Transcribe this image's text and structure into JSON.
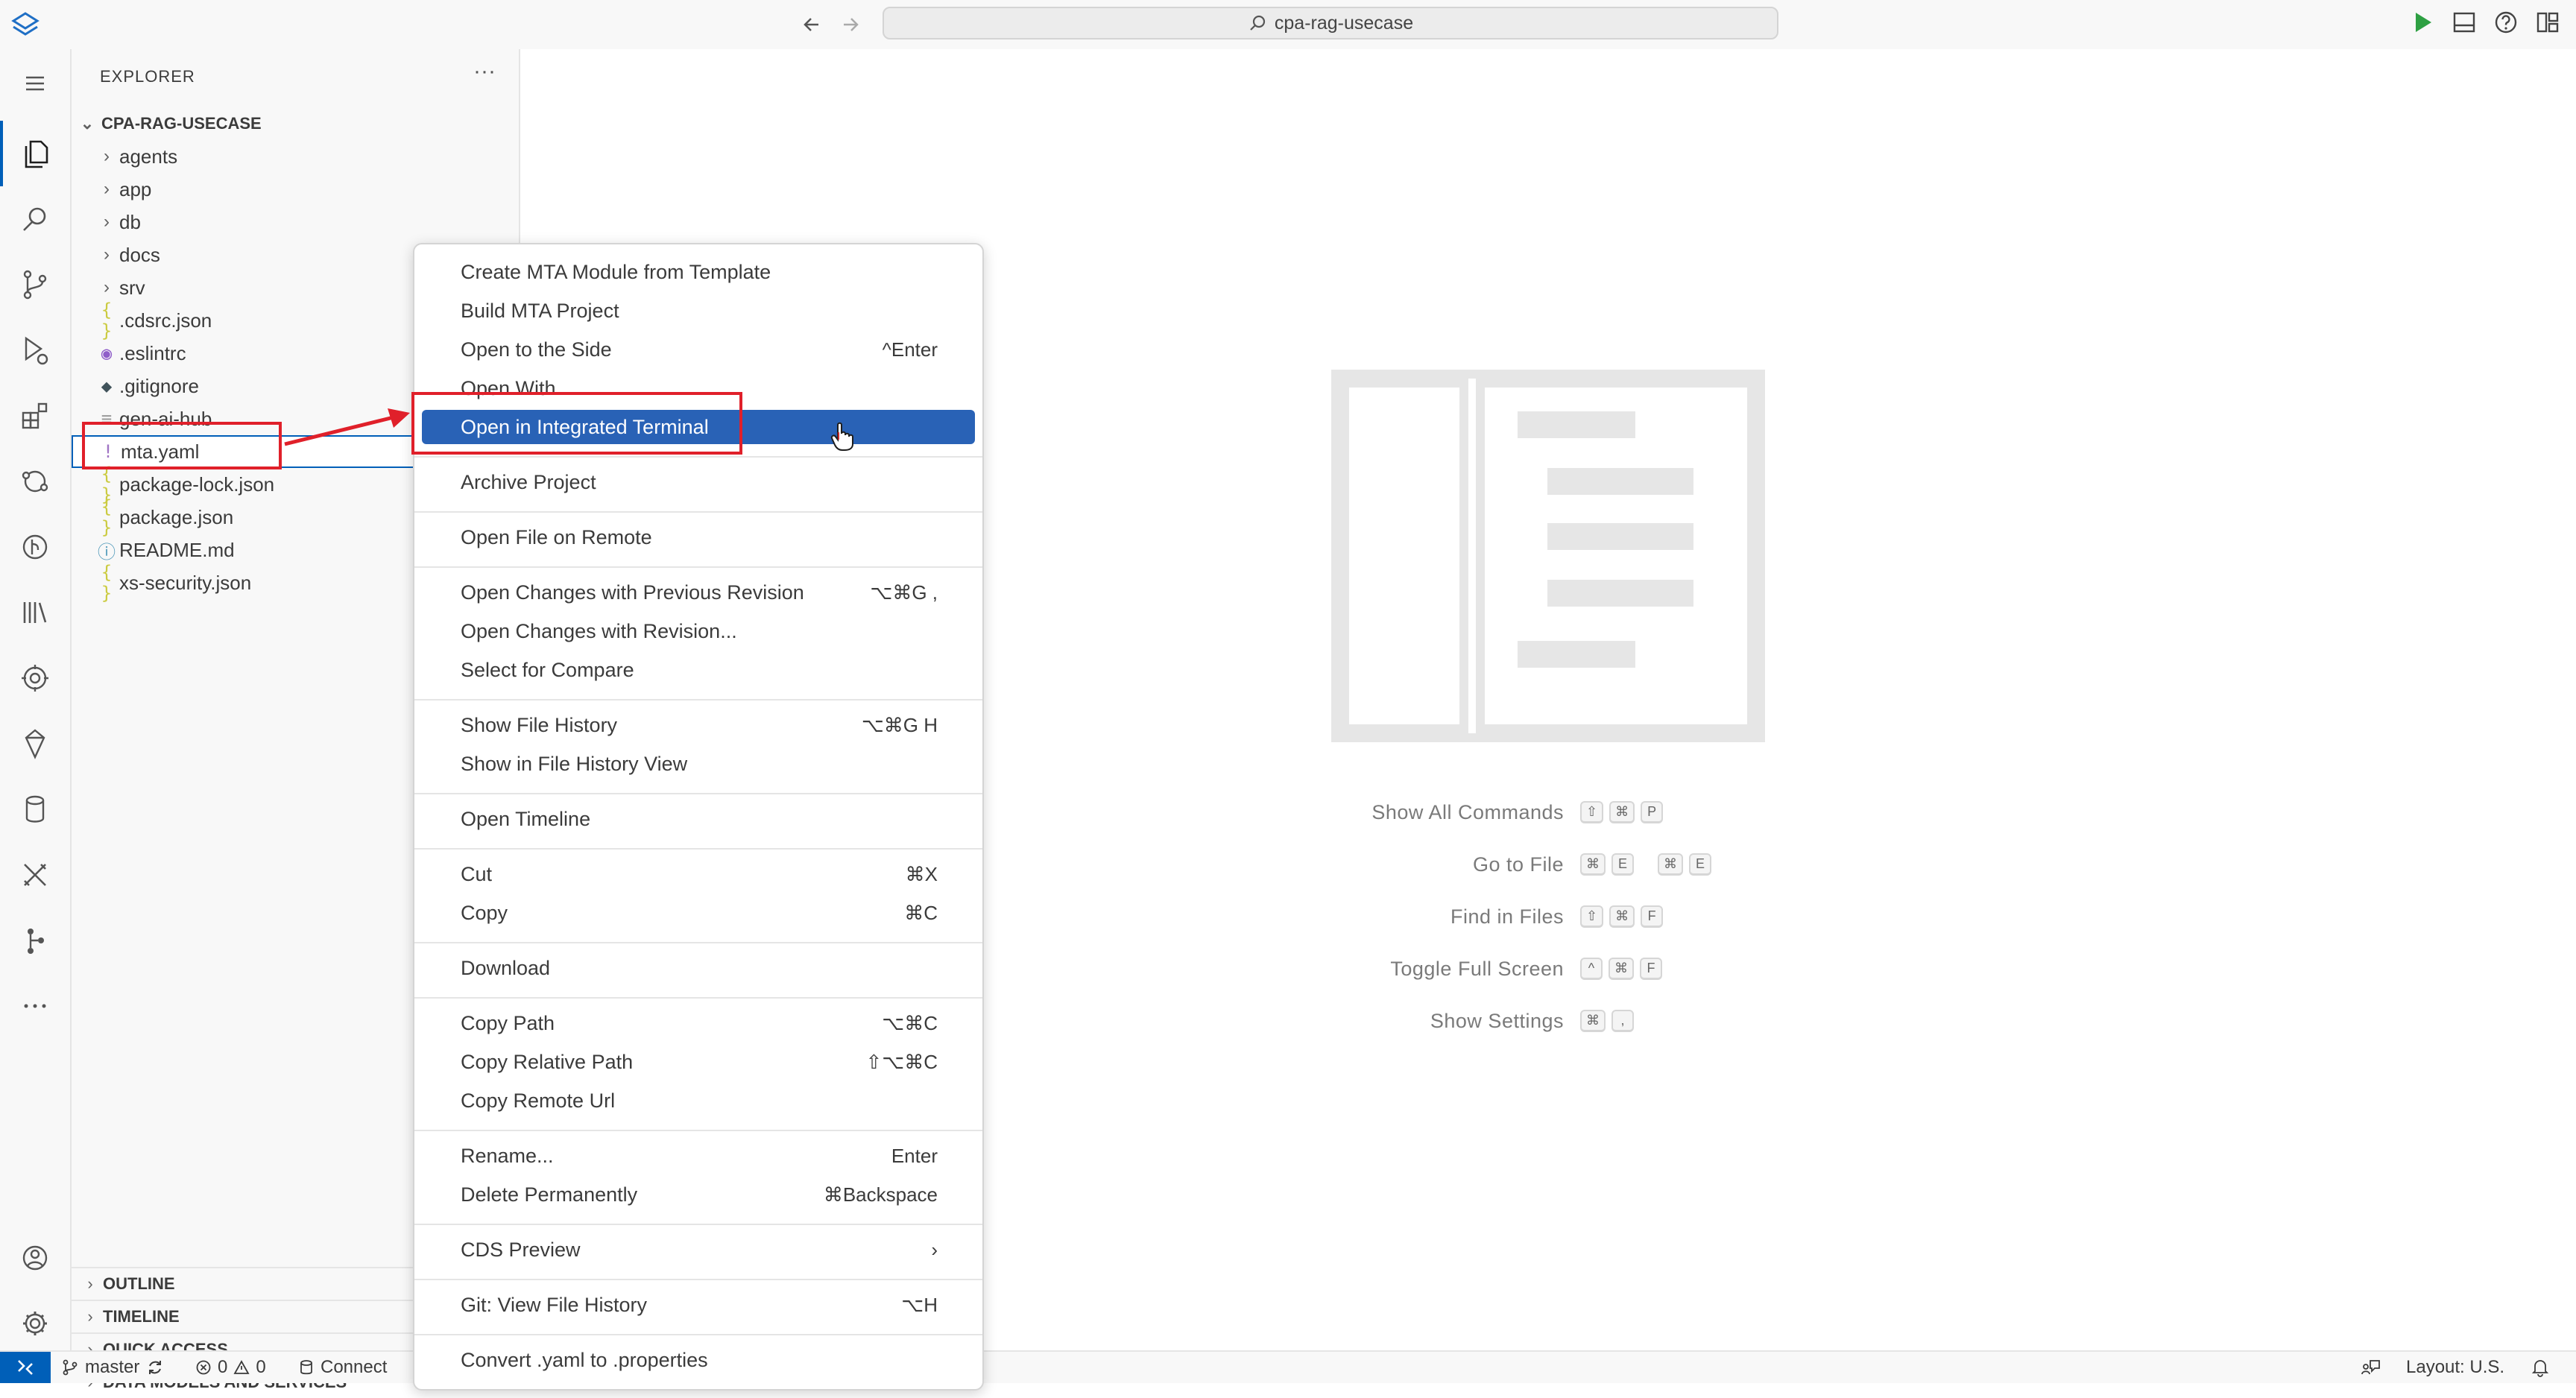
{
  "titlebar": {
    "search_text": "cpa-rag-usecase"
  },
  "sidebar": {
    "title": "EXPLORER",
    "more": "···",
    "root_folder": "CPA-RAG-USECASE",
    "items": [
      {
        "label": "agents",
        "type": "folder",
        "icon": "chevron-right-icon"
      },
      {
        "label": "app",
        "type": "folder",
        "icon": "chevron-right-icon"
      },
      {
        "label": "db",
        "type": "folder",
        "icon": "chevron-right-icon"
      },
      {
        "label": "docs",
        "type": "folder",
        "icon": "chevron-right-icon"
      },
      {
        "label": "srv",
        "type": "folder",
        "icon": "chevron-right-icon"
      },
      {
        "label": ".cdsrc.json",
        "type": "file",
        "icon": "json-icon",
        "glyph": "{ }",
        "color": "#cbcb41"
      },
      {
        "label": ".eslintrc",
        "type": "file",
        "icon": "eslint-icon",
        "glyph": "◉",
        "color": "#8f5ec9"
      },
      {
        "label": ".gitignore",
        "type": "file",
        "icon": "git-icon",
        "glyph": "◆",
        "color": "#41535b"
      },
      {
        "label": "gen-ai-hub",
        "type": "file",
        "icon": "file-lines-icon",
        "glyph": "≡",
        "color": "#9a9a9a"
      },
      {
        "label": "mta.yaml",
        "type": "file",
        "icon": "yaml-icon",
        "glyph": "!",
        "color": "#a074c4"
      },
      {
        "label": "package-lock.json",
        "type": "file",
        "icon": "json-icon",
        "glyph": "{ }",
        "color": "#cbcb41"
      },
      {
        "label": "package.json",
        "type": "file",
        "icon": "json-icon",
        "glyph": "{ }",
        "color": "#cbcb41"
      },
      {
        "label": "README.md",
        "type": "file",
        "icon": "info-icon",
        "glyph": "ⓘ",
        "color": "#519aba"
      },
      {
        "label": "xs-security.json",
        "type": "file",
        "icon": "json-icon",
        "glyph": "{ }",
        "color": "#cbcb41"
      }
    ],
    "sections": [
      "OUTLINE",
      "TIMELINE",
      "QUICK ACCESS",
      "DATA MODELS AND SERVICES"
    ]
  },
  "context_menu": {
    "groups": [
      [
        {
          "label": "Create MTA Module from Template",
          "shortcut": ""
        },
        {
          "label": "Build MTA Project",
          "shortcut": ""
        },
        {
          "label": "Open to the Side",
          "shortcut": "^Enter"
        },
        {
          "label": "Open With...",
          "shortcut": ""
        },
        {
          "label": "Open in Integrated Terminal",
          "shortcut": "",
          "highlighted": true
        }
      ],
      [
        {
          "label": "Archive Project",
          "shortcut": ""
        }
      ],
      [
        {
          "label": "Open File on Remote",
          "shortcut": ""
        }
      ],
      [
        {
          "label": "Open Changes with Previous Revision",
          "shortcut": "⌥⌘G ,"
        },
        {
          "label": "Open Changes with Revision...",
          "shortcut": ""
        },
        {
          "label": "Select for Compare",
          "shortcut": ""
        }
      ],
      [
        {
          "label": "Show File History",
          "shortcut": "⌥⌘G H"
        },
        {
          "label": "Show in File History View",
          "shortcut": ""
        }
      ],
      [
        {
          "label": "Open Timeline",
          "shortcut": ""
        }
      ],
      [
        {
          "label": "Cut",
          "shortcut": "⌘X"
        },
        {
          "label": "Copy",
          "shortcut": "⌘C"
        }
      ],
      [
        {
          "label": "Download",
          "shortcut": ""
        }
      ],
      [
        {
          "label": "Copy Path",
          "shortcut": "⌥⌘C"
        },
        {
          "label": "Copy Relative Path",
          "shortcut": "⇧⌥⌘C"
        },
        {
          "label": "Copy Remote Url",
          "shortcut": ""
        }
      ],
      [
        {
          "label": "Rename...",
          "shortcut": "Enter"
        },
        {
          "label": "Delete Permanently",
          "shortcut": "⌘Backspace"
        }
      ],
      [
        {
          "label": "CDS Preview",
          "shortcut": "›",
          "submenu": true
        }
      ],
      [
        {
          "label": "Git: View File History",
          "shortcut": "⌥H"
        }
      ],
      [
        {
          "label": "Convert .yaml to .properties",
          "shortcut": ""
        }
      ]
    ]
  },
  "welcome": {
    "shortcuts": [
      {
        "label": "Show All Commands",
        "keys": [
          [
            "⇧",
            "⌘",
            "P"
          ]
        ]
      },
      {
        "label": "Go to File",
        "keys": [
          [
            "⌘",
            "E"
          ],
          [
            "⌘",
            "E"
          ]
        ]
      },
      {
        "label": "Find in Files",
        "keys": [
          [
            "⇧",
            "⌘",
            "F"
          ]
        ]
      },
      {
        "label": "Toggle Full Screen",
        "keys": [
          [
            "^",
            "⌘",
            "F"
          ]
        ]
      },
      {
        "label": "Show Settings",
        "keys": [
          [
            "⌘",
            ","
          ]
        ]
      }
    ]
  },
  "statusbar": {
    "branch": "master",
    "errors": "0",
    "warnings": "0",
    "connect": "Connect",
    "layout": "Layout: U.S."
  },
  "colors": {
    "accent": "#005fb8",
    "menu_highlight": "#2962b6",
    "annotation_red": "#e0202a"
  }
}
